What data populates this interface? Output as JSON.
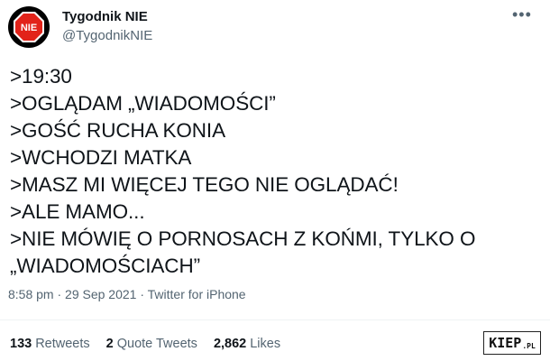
{
  "author": {
    "display_name": "Tygodnik NIE",
    "handle": "@TygodnikNIE",
    "avatar_text": "NIE"
  },
  "more_label": "•••",
  "tweet_lines": [
    ">19:30",
    ">OGLĄDAM „WIADOMOŚCI”",
    ">GOŚĆ RUCHA KONIA",
    ">WCHODZI MATKA",
    ">MASZ MI WIĘCEJ TEGO NIE OGLĄDAĆ!",
    ">ALE MAMO...",
    ">NIE MÓWIĘ O PORNOSACH Z KOŃMI, TYLKO O",
    "„WIADOMOŚCIACH”"
  ],
  "meta": {
    "time": "8:58 pm",
    "sep1": " · ",
    "date": "29 Sep 2021",
    "sep2": " · ",
    "source": "Twitter for iPhone"
  },
  "stats": {
    "retweets_count": "133",
    "retweets_label": "Retweets",
    "quotes_count": "2",
    "quotes_label": "Quote Tweets",
    "likes_count": "2,862",
    "likes_label": "Likes"
  },
  "watermark": {
    "main": "KIEP",
    "suffix": ".PL"
  },
  "colors": {
    "text": "#0f1419",
    "secondary": "#536471",
    "avatar_red": "#e2231a"
  }
}
